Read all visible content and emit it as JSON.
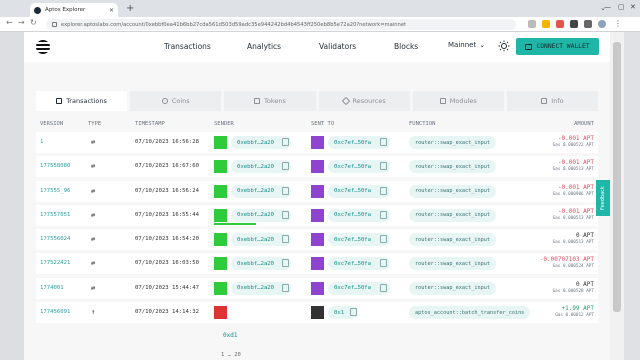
{
  "browser": {
    "tab_title": "Aptos Explorer",
    "tab_close": "✕",
    "new_tab": "+",
    "url": "explorer.aptoslabs.com/account/0xebbf0ea41b6bb27cda561d503d59adc35e944242bd4b4543ff250eb8b5e72a20?network=mainnet"
  },
  "nav": {
    "links": [
      "Transactions",
      "Analytics",
      "Validators",
      "Blocks"
    ],
    "network": "Mainnet",
    "network_caret": "⌄",
    "connect_wallet": "CONNECT WALLET"
  },
  "tabs": [
    {
      "label": "Transactions",
      "active": true
    },
    {
      "label": "Coins",
      "active": false
    },
    {
      "label": "Tokens",
      "active": false
    },
    {
      "label": "Resources",
      "active": false
    },
    {
      "label": "Modules",
      "active": false
    },
    {
      "label": "Info",
      "active": false
    }
  ],
  "table": {
    "headers": {
      "version": "VERSION",
      "type": "TYPE",
      "timestamp": "TIMESTAMP",
      "sender": "SENDER",
      "sent_to": "SENT TO",
      "function": "FUNCTION",
      "amount": "AMOUNT"
    },
    "rows": [
      {
        "version": "1",
        "type_icon": "⇄",
        "timestamp": "07/10/2023 16:56:28",
        "sender": "0xebbf…2a20",
        "sent_to": "0xc7ef…50fa",
        "function": "router::swap_exact_input",
        "amount": "-0.001 APT",
        "gas": "Gas 0.000522 APT",
        "amount_class": "neg"
      },
      {
        "version": "177558080",
        "type_icon": "⇄",
        "timestamp": "07/10/2023 16:67:60",
        "sender": "0xebbf…2a20",
        "sent_to": "0xc7ef…50fa",
        "function": "router::swap_exact_input",
        "amount": "-0.001 APT",
        "gas": "Gas 0.000513 APT",
        "amount_class": "neg"
      },
      {
        "version": "177555_96",
        "type_icon": "⇄",
        "timestamp": "07/10/2023 16:56:24",
        "sender": "0xebbf…2a20",
        "sent_to": "0xc7ef…50fa",
        "function": "router::swap_exact_input",
        "amount": "-0.001 APT",
        "gas": "Gas 0.000906 APT",
        "amount_class": "neg"
      },
      {
        "version": "177557051",
        "type_icon": "⇄",
        "timestamp": "07/10/2023 16:55:44",
        "sender": "0xebbf…2a20",
        "sent_to": "0xc7ef…50fa",
        "function": "router::swap_exact_input",
        "amount": "-0.001 APT",
        "gas": "Gas 0.000513 APT",
        "amount_class": "neg"
      },
      {
        "version": "177556024",
        "type_icon": "⇄",
        "timestamp": "07/10/2023 16:54:20",
        "sender": "0xebbf…2a20",
        "sent_to": "0xc7ef…50fa",
        "function": "router::swap_exact_input",
        "amount": "0 APT",
        "gas": "Gas 0.000513 APT",
        "amount_class": "neu"
      },
      {
        "version": "177522421",
        "type_icon": "⇄",
        "timestamp": "07/10/2023 16:03:50",
        "sender": "0xebbf…2a20",
        "sent_to": "0xc7ef…50fa",
        "function": "router::swap_exact_input",
        "amount": "-0.00707103 APT",
        "gas": "Gas 0.000524 APT",
        "amount_class": "neg"
      },
      {
        "version": "1774001",
        "type_icon": "⇄",
        "timestamp": "07/10/2023 15:44:47",
        "sender": "0xebbf…2a20",
        "sent_to": "0xc7ef…50fa",
        "function": "router::swap_exact_input",
        "amount": "0 APT",
        "gas": "Gas 0.000528 APT",
        "amount_class": "neu"
      },
      {
        "version": "177456091",
        "type_icon": "↑",
        "timestamp": "07/10/2023 14:14:32",
        "sender": "",
        "sent_to": "0x1",
        "function": "aptos_account::batch_transfer_coins",
        "amount": "+1.99 APT",
        "gas": "Gas 0.00012 APT",
        "amount_class": "pos"
      }
    ]
  },
  "footer": {
    "extra_addr": "0xd1",
    "pagination": "1 … 20"
  },
  "feedback": "Feedback"
}
